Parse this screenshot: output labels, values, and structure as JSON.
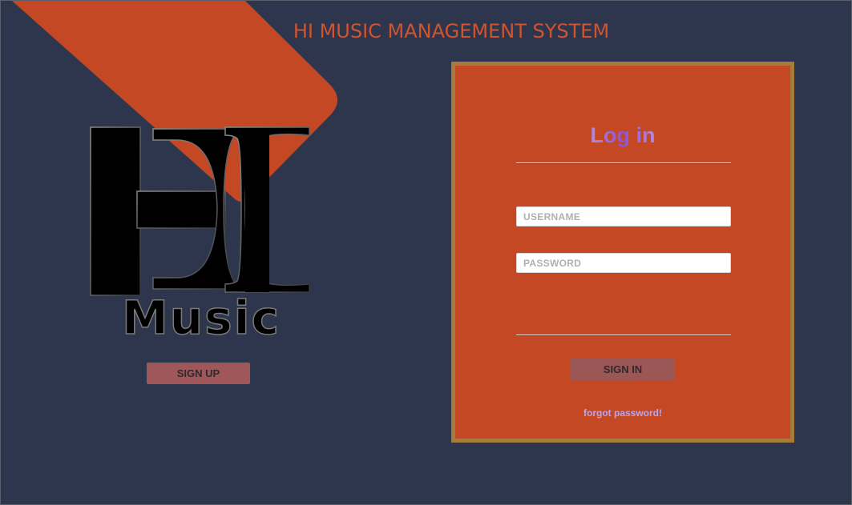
{
  "app": {
    "title": "HI MUSIC MANAGEMENT SYSTEM"
  },
  "logo": {
    "icon": "hi-music-logo-icon",
    "text": "Music"
  },
  "left": {
    "signup_label": "SIGN UP"
  },
  "login": {
    "title": "Log in",
    "username_placeholder": "USERNAME",
    "password_placeholder": "PASSWORD",
    "signin_label": "SIGN IN",
    "forgot_label": "forgot password!"
  },
  "colors": {
    "background": "#2e364e",
    "accent": "#c44824",
    "panel_border": "#a77b3d",
    "button": "#a0575a",
    "link": "#b7a6ee"
  }
}
